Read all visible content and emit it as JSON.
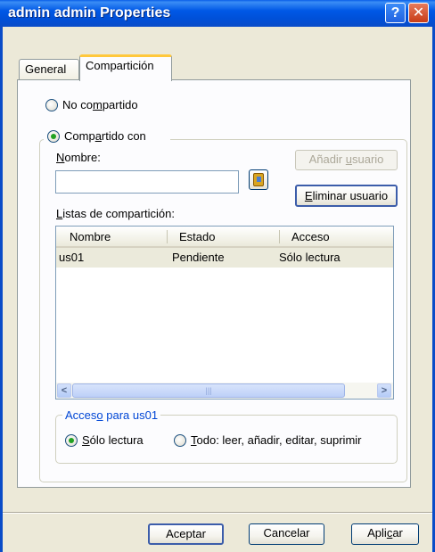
{
  "window": {
    "title": "admin admin Properties",
    "help_symbol": "?",
    "close_symbol": "✕"
  },
  "tabs": [
    {
      "label": "General"
    },
    {
      "label": "Compartición"
    }
  ],
  "sharing": {
    "not_shared": {
      "prefix": "No co",
      "mnemonic": "m",
      "suffix": "partido",
      "checked": false
    },
    "shared_with": {
      "prefix": "Comp",
      "mnemonic": "a",
      "suffix": "rtido con",
      "checked": true
    },
    "name_label": {
      "mnemonic": "N",
      "suffix": "ombre:"
    },
    "name_value": "",
    "address_book_icon": "address-book-icon",
    "add_user": {
      "prefix": "Añadir ",
      "mnemonic": "u",
      "suffix": "suario",
      "enabled": false
    },
    "remove_user": {
      "mnemonic": "E",
      "suffix": "liminar usuario",
      "enabled": true
    },
    "lists_label": {
      "mnemonic": "L",
      "suffix": "istas de compartición:"
    },
    "columns": [
      "Nombre",
      "Estado",
      "Acceso"
    ],
    "rows": [
      {
        "nombre": "us01",
        "estado": "Pendiente",
        "acceso": "Sólo lectura"
      }
    ],
    "scroll_left": "<",
    "scroll_right": ">",
    "scroll_grip": "|||"
  },
  "access": {
    "legend": {
      "prefix": "Acces",
      "mnemonic": "o",
      "suffix": " para us01"
    },
    "read_only": {
      "mnemonic": "S",
      "suffix": "ólo lectura",
      "checked": true
    },
    "full": {
      "mnemonic": "T",
      "suffix": "odo: leer, añadir, editar, suprimir",
      "checked": false
    }
  },
  "footer": {
    "ok": "Aceptar",
    "cancel": "Cancelar",
    "apply": {
      "prefix": "Apli",
      "mnemonic": "c",
      "suffix": "ar"
    }
  },
  "colors": {
    "titlebar": "#0058E6",
    "face": "#ECE9D8",
    "legend_text": "#0046D5",
    "selected_row": "#EBEADB"
  }
}
